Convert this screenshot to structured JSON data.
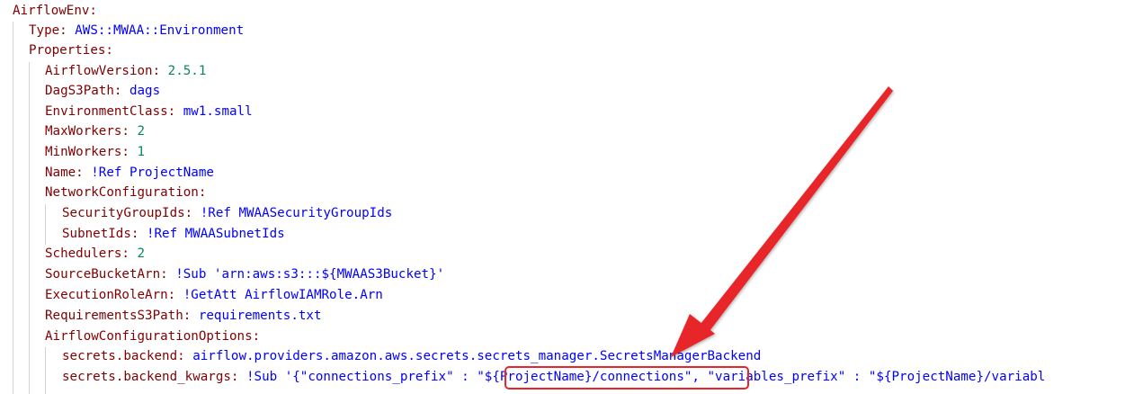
{
  "lines": [
    {
      "key": "AirflowEnv:",
      "value": "",
      "vtype": "val"
    },
    {
      "key": "Type:",
      "value": " AWS::MWAA::Environment",
      "vtype": "val"
    },
    {
      "key": "Properties:",
      "value": "",
      "vtype": "val"
    },
    {
      "key": "AirflowVersion:",
      "value": " 2.5.1",
      "vtype": "num"
    },
    {
      "key": "DagS3Path:",
      "value": " dags",
      "vtype": "val"
    },
    {
      "key": "EnvironmentClass:",
      "value": " mw1.small",
      "vtype": "val"
    },
    {
      "key": "MaxWorkers:",
      "value": " 2",
      "vtype": "num"
    },
    {
      "key": "MinWorkers:",
      "value": " 1",
      "vtype": "num"
    },
    {
      "key": "Name:",
      "value": " !Ref ProjectName",
      "vtype": "val"
    },
    {
      "key": "NetworkConfiguration:",
      "value": "",
      "vtype": "val"
    },
    {
      "key": "SecurityGroupIds:",
      "value": " !Ref MWAASecurityGroupIds",
      "vtype": "val"
    },
    {
      "key": "SubnetIds:",
      "value": " !Ref MWAASubnetIds",
      "vtype": "val"
    },
    {
      "key": "Schedulers:",
      "value": " 2",
      "vtype": "num"
    },
    {
      "key": "SourceBucketArn:",
      "value": " !Sub 'arn:aws:s3:::${MWAAS3Bucket}'",
      "vtype": "val"
    },
    {
      "key": "ExecutionRoleArn:",
      "value": " !GetAtt AirflowIAMRole.Arn",
      "vtype": "val"
    },
    {
      "key": "RequirementsS3Path:",
      "value": " requirements.txt",
      "vtype": "val"
    },
    {
      "key": "AirflowConfigurationOptions:",
      "value": "",
      "vtype": "val"
    },
    {
      "key": "secrets.backend:",
      "value": " airflow.providers.amazon.aws.secrets.secrets_manager.SecretsManagerBackend",
      "vtype": "val"
    },
    {
      "key": "secrets.backend_kwargs:",
      "value": " !Sub '{\"connections_prefix\" : \"${ProjectName}/connections\", \"variables_prefix\" : \"${ProjectName}/variabl",
      "vtype": "val"
    }
  ],
  "colors": {
    "key": "#800000",
    "value": "#0000ff",
    "number": "#098658",
    "annotation": "#e8252a"
  },
  "annotation": {
    "highlighted_text": "\"${ProjectName}/connections\"",
    "arrow_icon": "red-arrow-icon"
  }
}
